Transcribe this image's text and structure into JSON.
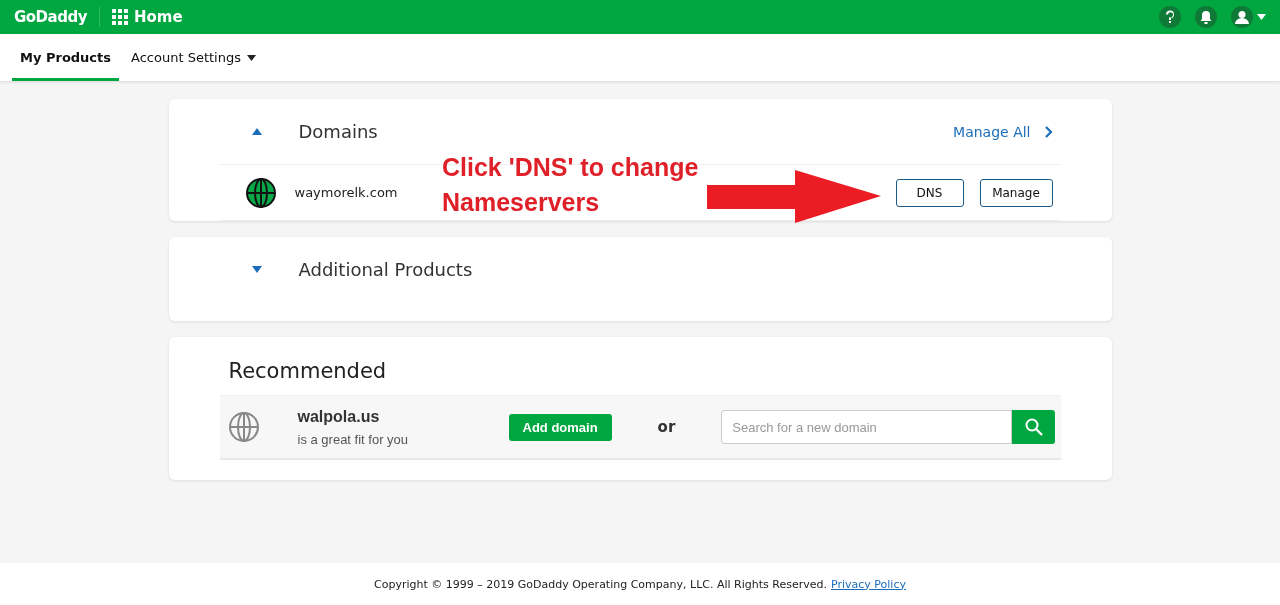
{
  "header": {
    "logo": "GoDaddy",
    "home": "Home"
  },
  "tabs": [
    {
      "label": "My Products",
      "selected": true,
      "dropdown": false
    },
    {
      "label": "Account Settings",
      "selected": false,
      "dropdown": true
    }
  ],
  "sections": [
    {
      "title": "Domains",
      "expanded": true,
      "link": "Manage All",
      "domains": [
        {
          "name": "waymorelk.com",
          "buttons": [
            "DNS",
            "Manage"
          ]
        }
      ]
    },
    {
      "title": "Additional Products",
      "expanded": false
    }
  ],
  "recommended": {
    "title": "Recommended",
    "domain": "walpola.us",
    "subtitle": "is a great fit for you",
    "add_button": "Add domain",
    "or": "or",
    "search": {
      "placeholder": "Search for a new domain"
    }
  },
  "annotation": "Click 'DNS' to change Nameservers",
  "footer": {
    "text": "Copyright © 1999 – 2019 GoDaddy Operating Company, LLC. All Rights Reserved.",
    "link": "Privacy Policy"
  }
}
